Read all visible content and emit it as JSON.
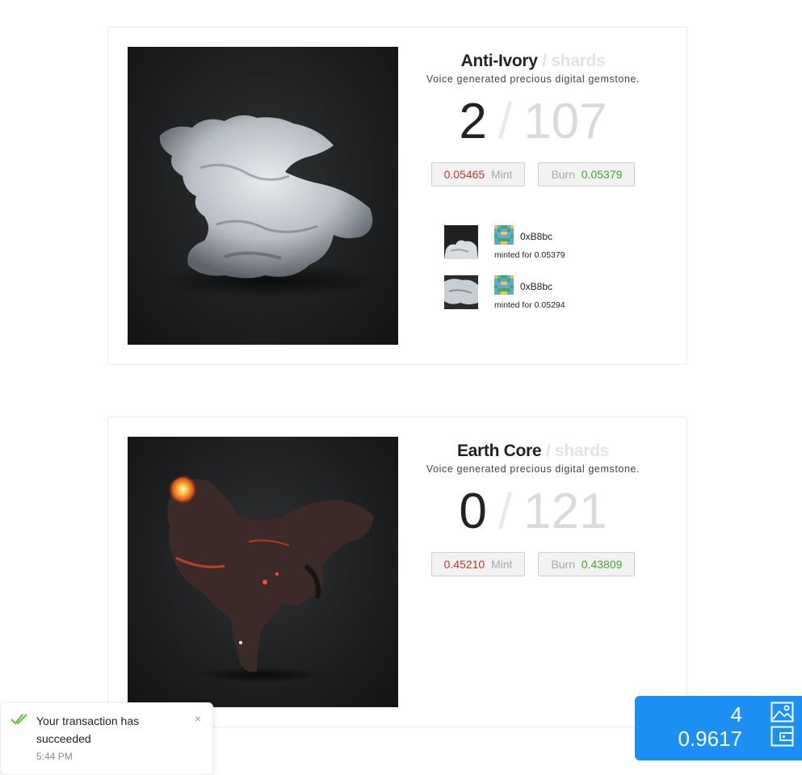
{
  "cards": [
    {
      "title": "Anti-Ivory",
      "title_suffix": "shards",
      "subtitle": "Voice generated precious digital gemstone.",
      "minted": "2",
      "total": "107",
      "mint_price": "0.05465",
      "mint_label": "Mint",
      "burn_label": "Burn",
      "burn_price": "0.05379",
      "history": [
        {
          "address": "0xB8bc",
          "price_text": "minted for 0.05379"
        },
        {
          "address": "0xB8bc",
          "price_text": "minted for 0.05294"
        }
      ]
    },
    {
      "title": "Earth Core",
      "title_suffix": "shards",
      "subtitle": "Voice generated precious digital gemstone.",
      "minted": "0",
      "total": "121",
      "mint_price": "0.45210",
      "mint_label": "Mint",
      "burn_label": "Burn",
      "burn_price": "0.43809"
    }
  ],
  "toast": {
    "message": "Your transaction has succeeded",
    "time": "5:44 PM",
    "close_glyph": "×"
  },
  "wallet": {
    "count": "4",
    "balance": "0.9617"
  },
  "colors": {
    "mint_price": "#c0392b",
    "burn_price": "#44a22a",
    "wallet_bg": "#1b8ff3",
    "success_check": "#6cc24a"
  }
}
